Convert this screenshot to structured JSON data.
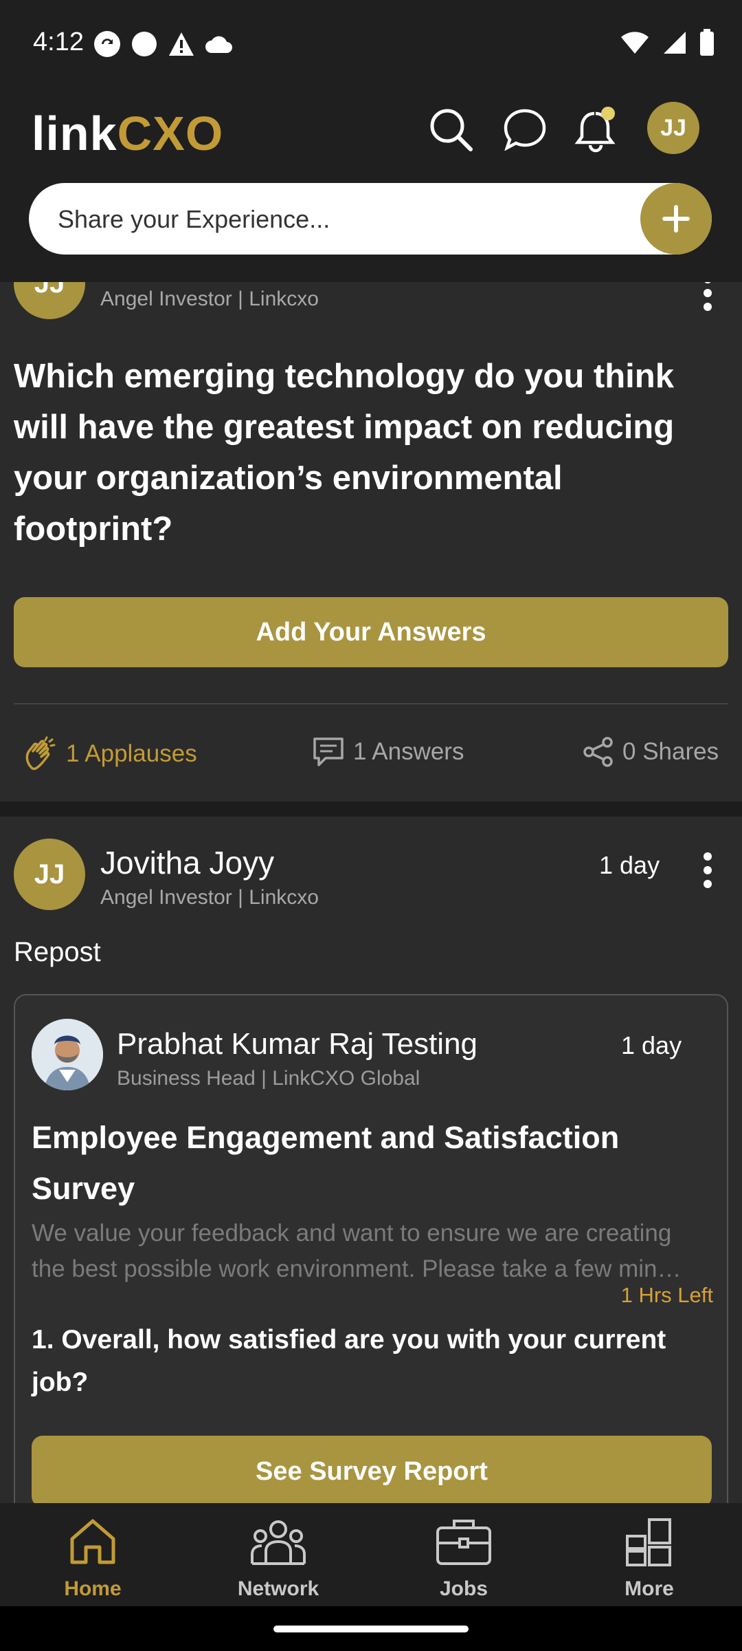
{
  "status_bar": {
    "time": "4:12"
  },
  "header": {
    "logo_part1": "link",
    "logo_part2": "CXO",
    "avatar_initials": "JJ",
    "share_placeholder": "Share your Experience..."
  },
  "post1": {
    "author_subtitle": "Angel Investor | Linkcxo",
    "avatar_initials": "JJ",
    "question": "Which emerging technology do you think will have the greatest impact on reducing your organization’s environmental footprint?",
    "answer_button": "Add Your Answers",
    "applauses": "1 Applauses",
    "answers": "1 Answers",
    "shares": "0 Shares"
  },
  "post2": {
    "avatar_initials": "JJ",
    "author_name": "Jovitha Joyy",
    "author_subtitle": "Angel Investor | Linkcxo",
    "time": "1 day",
    "repost_label": "Repost",
    "shared": {
      "author_name": "Prabhat Kumar Raj Testing",
      "author_subtitle": "Business Head | LinkCXO Global",
      "time": "1 day",
      "title": "Employee Engagement and Satisfaction Survey",
      "desc_line1": "We value your feedback and want to ensure we are creating",
      "desc_line2": "the best possible work environment. Please take a few min…",
      "time_left": "1 Hrs Left",
      "question": "1. Overall, how satisfied are you with your current job?",
      "button": "See Survey Report"
    }
  },
  "bottom_nav": {
    "items": [
      {
        "label": "Home",
        "icon": "home-icon",
        "active": true
      },
      {
        "label": "Network",
        "icon": "network-icon",
        "active": false
      },
      {
        "label": "Jobs",
        "icon": "briefcase-icon",
        "active": false
      },
      {
        "label": "More",
        "icon": "grid-icon",
        "active": false
      }
    ]
  },
  "colors": {
    "accent": "#a99440",
    "gold_text": "#c29b36",
    "background": "#1c1c1c",
    "card": "#2b2b2b"
  }
}
